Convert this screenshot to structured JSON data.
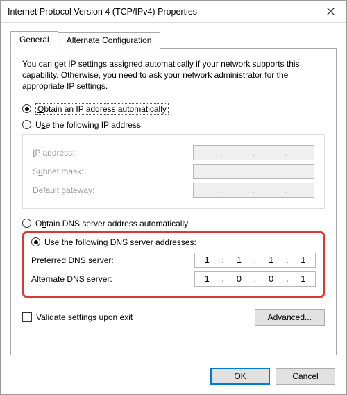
{
  "window": {
    "title": "Internet Protocol Version 4 (TCP/IPv4) Properties"
  },
  "tabs": {
    "general": "General",
    "alternate": "Alternate Configuration"
  },
  "description": "You can get IP settings assigned automatically if your network supports this capability. Otherwise, you need to ask your network administrator for the appropriate IP settings.",
  "ip": {
    "auto_label_pre": "O",
    "auto_label_post": "btain an IP address automatically",
    "manual_label_pre": "Use the following IP address:",
    "manual_u": "S",
    "ip_address_label": "IP address:",
    "ip_u": "I",
    "subnet_label": "Subnet mask:",
    "subnet_u": "u",
    "gateway_label": "Default gateway:",
    "gateway_u": "D"
  },
  "dns": {
    "auto_label": "Obtain DNS server address automatically",
    "auto_u": "b",
    "manual_label": "Use the following DNS server addresses:",
    "manual_u": "e",
    "preferred_label": "Preferred DNS server:",
    "preferred_u": "P",
    "alternate_label": "Alternate DNS server:",
    "alternate_u": "A",
    "preferred_value": [
      "1",
      "1",
      "1",
      "1"
    ],
    "alternate_value": [
      "1",
      "0",
      "0",
      "1"
    ]
  },
  "validate": {
    "label": "Validate settings upon exit",
    "u": "l"
  },
  "buttons": {
    "advanced": "Advanced...",
    "advanced_u": "v",
    "ok": "OK",
    "cancel": "Cancel"
  }
}
